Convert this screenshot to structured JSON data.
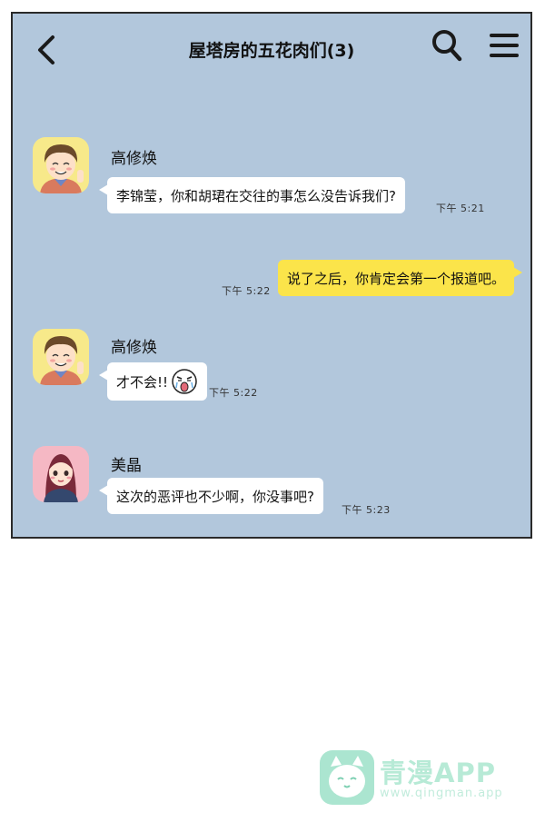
{
  "header": {
    "title": "屋塔房的五花肉们(3)",
    "back_icon": "chevron-left-icon",
    "search_icon": "search-icon",
    "menu_icon": "hamburger-menu-icon"
  },
  "messages": [
    {
      "sender": "高修焕",
      "text": "李锦莹，你和胡珺在交往的事怎么没告诉我们?",
      "time": "下午 5:21",
      "side": "left"
    },
    {
      "sender": "",
      "text": "说了之后，你肯定会第一个报道吧。",
      "time": "下午 5:22",
      "side": "right"
    },
    {
      "sender": "高修焕",
      "text": "才不会!!",
      "time": "下午 5:22",
      "side": "left",
      "emoticon": "crying-face-icon"
    },
    {
      "sender": "美晶",
      "text": "这次的恶评也不少啊，你没事吧?",
      "time": "下午 5:23",
      "side": "left"
    }
  ],
  "watermark": {
    "brand": "青漫APP",
    "url": "www.qingman.app",
    "logo_icon": "cat-logo-icon"
  },
  "colors": {
    "chat_background": "#b2c7dc",
    "own_bubble": "#fbe44a",
    "other_bubble": "#ffffff"
  }
}
